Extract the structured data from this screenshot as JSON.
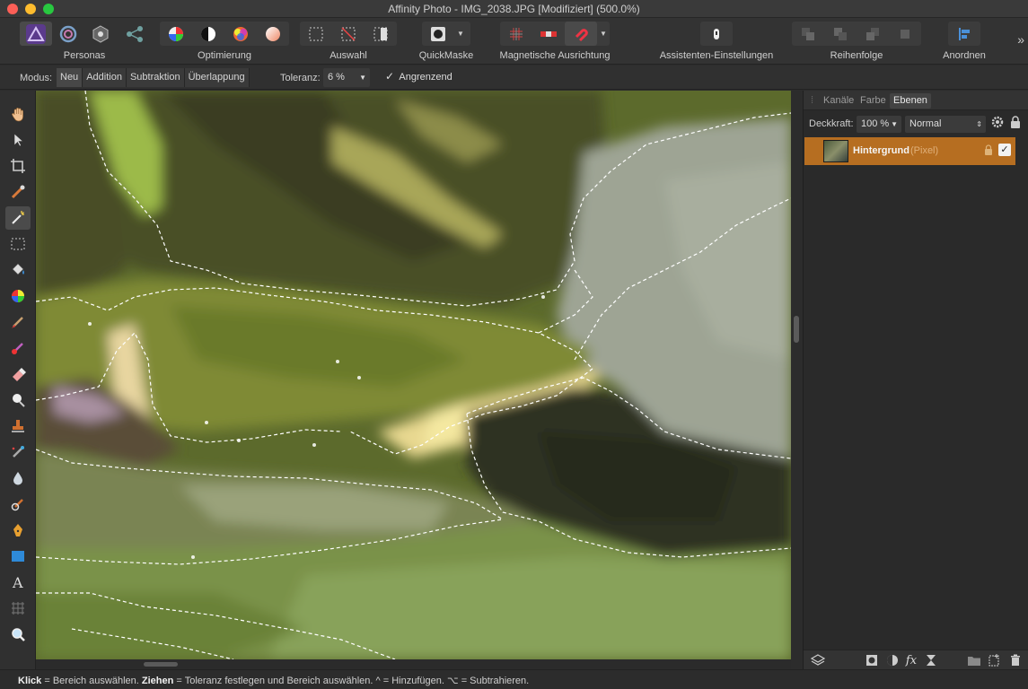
{
  "window": {
    "title": "Affinity Photo - IMG_2038.JPG [Modifiziert] (500.0%)"
  },
  "toolbar": {
    "groups": [
      {
        "label": "Personas"
      },
      {
        "label": "Optimierung"
      },
      {
        "label": "Auswahl"
      },
      {
        "label": "QuickMaske"
      },
      {
        "label": "Magnetische Ausrichtung"
      },
      {
        "label": "Assistenten-Einstellungen"
      },
      {
        "label": "Reihenfolge"
      },
      {
        "label": "Anordnen"
      }
    ]
  },
  "context": {
    "mode_label": "Modus:",
    "modes": [
      "Neu",
      "Addition",
      "Subtraktion",
      "Überlappung"
    ],
    "tolerance_label": "Toleranz:",
    "tolerance_value": "6 %",
    "contiguous_label": "Angrenzend"
  },
  "panel": {
    "tabs": [
      "Kanäle",
      "Farbe",
      "Ebenen"
    ],
    "opacity_label": "Deckkraft:",
    "opacity_value": "100 %",
    "blend_mode": "Normal",
    "layers": [
      {
        "name": "Hintergrund",
        "type": "(Pixel)",
        "visible": true
      }
    ]
  },
  "status": {
    "klick": "Klick",
    "t1": " = Bereich auswählen. ",
    "ziehen": "Ziehen",
    "t2": " = Toleranz festlegen und Bereich auswählen. ^ = Hinzufügen. ⌥ = Subtrahieren."
  },
  "colors": {
    "accent": "#b66e21",
    "window_bg": "#2c2c2c"
  }
}
